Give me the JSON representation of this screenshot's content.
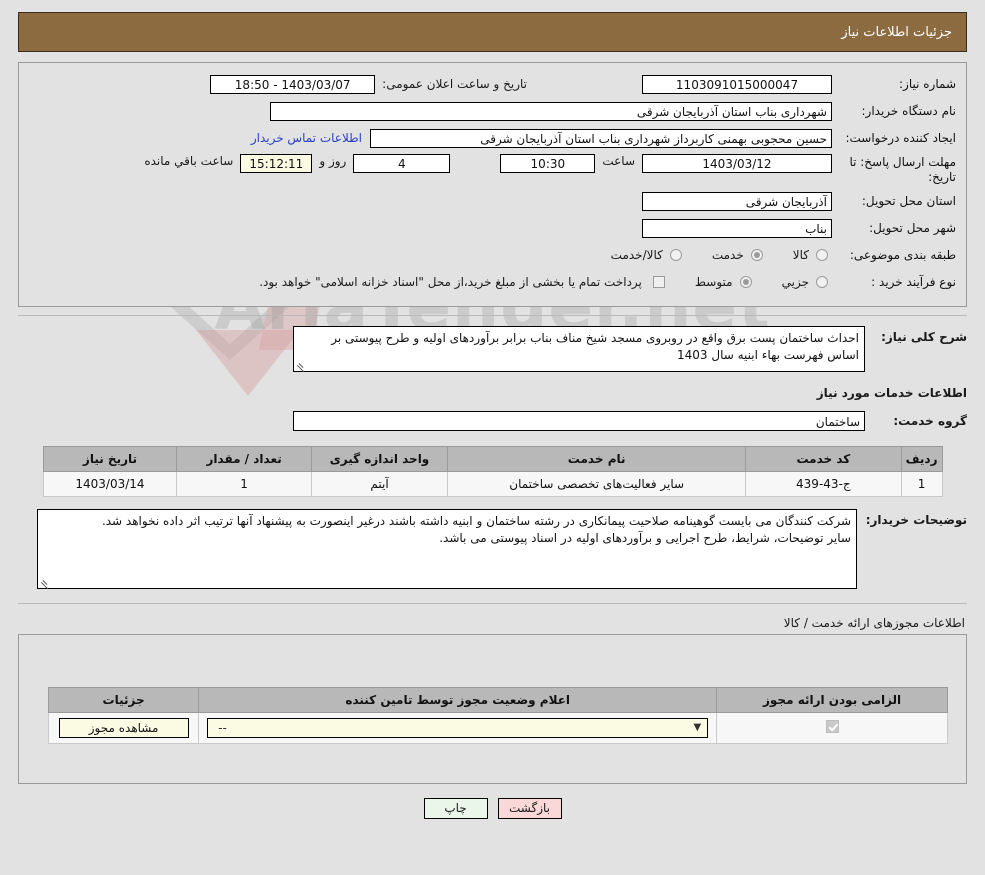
{
  "header": {
    "title": "جزئیات اطلاعات نیاز"
  },
  "need": {
    "labels": {
      "need_number": "شماره نیاز:",
      "buyer_org": "نام دستگاه خریدار:",
      "creator": "ایجاد کننده درخواست:",
      "deadline": "مهلت ارسال پاسخ: تا تاریخ:",
      "province": "استان محل تحویل:",
      "city": "شهر محل تحویل:",
      "category": "طبقه بندی موضوعی:",
      "process_type": "نوع فرآیند خرید :",
      "public_announce": "تاریخ و ساعت اعلان عمومی:",
      "hour": "ساعت",
      "day_and": "روز و",
      "remaining": "ساعت باقي مانده",
      "contact_link": "اطلاعات تماس خریدار"
    },
    "values": {
      "need_number": "1103091015000047",
      "buyer_org": "شهرداری بناب استان آذربایجان شرقی",
      "creator": "حسین محجوبی بهمنی کاربرداز شهرداری بناب استان آذربایجان شرقی",
      "deadline_date": "1403/03/12",
      "deadline_hour": "10:30",
      "remaining_days": "4",
      "remaining_time": "15:12:11",
      "public_announce": "1403/03/07 - 18:50",
      "empty_field": "",
      "province": "آذربایجان شرقی",
      "city": "بناب"
    },
    "category_options": [
      {
        "label": "کالا",
        "checked": false
      },
      {
        "label": "خدمت",
        "checked": true
      },
      {
        "label": "کالا/خدمت",
        "checked": false
      }
    ],
    "process_options": [
      {
        "label": "جزیي",
        "checked": false
      },
      {
        "label": "متوسط",
        "checked": true
      }
    ],
    "treasury_note": "پرداخت تمام یا بخشی از مبلغ خرید،از محل \"اسناد خزانه اسلامی\" خواهد بود."
  },
  "summary": {
    "label": "شرح کلی نیاز:",
    "text": "احداث ساختمان پست برق واقع در روبروی مسجد شیخ مناف بناب برابر برآوردهای اولیه و طرح پیوستی بر اساس فهرست بهاء ابنیه  سال 1403"
  },
  "services": {
    "section_title": "اطلاعات خدمات مورد نیاز",
    "group_label": "گروه خدمت:",
    "group_value": "ساختمان",
    "columns": [
      "ردیف",
      "کد خدمت",
      "نام خدمت",
      "واحد اندازه گیری",
      "تعداد / مقدار",
      "تاریخ نیاز"
    ],
    "rows": [
      {
        "row_no": "1",
        "service_code": "ج-43-439",
        "service_name": "سایر فعالیت‌های تخصصی ساختمان",
        "unit": "آیتم",
        "quantity": "1",
        "need_date": "1403/03/14"
      }
    ]
  },
  "buyer_notes": {
    "label": "توضیحات خریدار:",
    "line1": "شرکت کنندگان می بایست گوهینامه صلاحیت پیمانکاری در رشته ساختمان و ابنیه داشته باشند درغیر اینصورت به پیشنهاد آنها ترتیب اثر داده نخواهد شد.",
    "line2": "سایر توضیحات، شرایط، طرح اجرایی و برآوردهای اولیه در اسناد پیوستی می باشد."
  },
  "permits": {
    "section_title": "اطلاعات مجوزهای ارائه خدمت / کالا",
    "columns": [
      "الزامی بودن ارائه مجوز",
      "اعلام وضعیت مجوز توسط تامین کننده",
      "جزئیات"
    ],
    "rows": [
      {
        "required_checked": true,
        "status_value": "--",
        "detail_button": "مشاهده مجوز"
      }
    ]
  },
  "footer": {
    "print_label": "چاپ",
    "back_label": "بازگشت"
  },
  "watermark": {
    "text": "AriaTender.net"
  },
  "colors": {
    "title_bar": "#8b6b3f",
    "page_bg": "#e2e2e2",
    "link": "#2c3ec4",
    "table_header": "#b8b8b8",
    "print_btn": "#eaf6ea",
    "back_btn": "#fbd8d8",
    "field_yellow": "#fbfbe4"
  }
}
